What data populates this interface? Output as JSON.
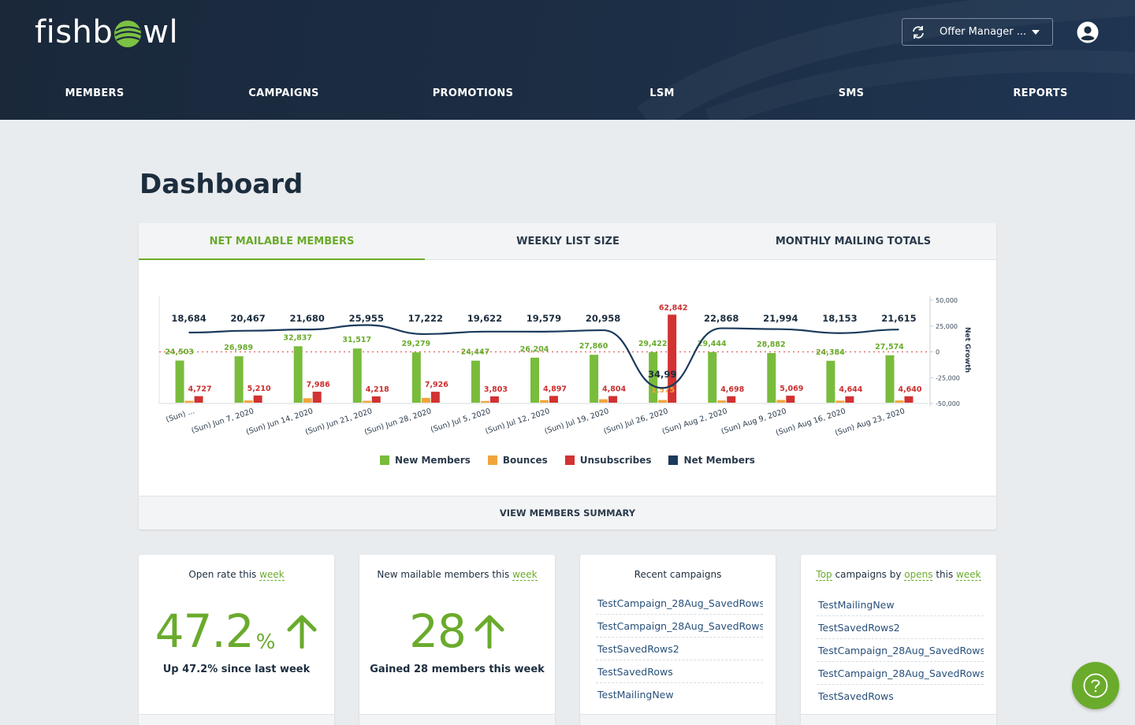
{
  "header": {
    "logo_text_left": "fishb",
    "logo_text_right": "wl",
    "account_selector": "Offer Manager ...",
    "icons": {
      "sync": "refresh-icon",
      "caret": "caret-down-icon",
      "user": "user-circle-icon"
    }
  },
  "nav": [
    "MEMBERS",
    "CAMPAIGNS",
    "PROMOTIONS",
    "LSM",
    "SMS",
    "REPORTS"
  ],
  "page_title": "Dashboard",
  "tabs": [
    "NET MAILABLE MEMBERS",
    "WEEKLY LIST SIZE",
    "MONTHLY MAILING TOTALS"
  ],
  "active_tab": "NET MAILABLE MEMBERS",
  "colors": {
    "accent": "#6aab2c",
    "new_members": "#79bc3c",
    "bounces": "#f0a53c",
    "unsubscribes": "#d23232",
    "net_members": "#1b3a5c"
  },
  "chart_data": {
    "type": "bar",
    "categories": [
      "(Sun) ...",
      "(Sun) Jun 7, 2020",
      "(Sun) Jun 14, 2020",
      "(Sun) Jun 21, 2020",
      "(Sun) Jun 28, 2020",
      "(Sun) Jul 5, 2020",
      "(Sun) Jul 12, 2020",
      "(Sun) Jul 19, 2020",
      "(Sun) Jul 26, 2020",
      "(Sun) Aug 2, 2020",
      "(Sun) Aug 9, 2020",
      "(Sun) Aug 16, 2020",
      "(Sun) Aug 23, 2020"
    ],
    "series": [
      {
        "name": "New Members",
        "type": "bar",
        "values": [
          24503,
          26989,
          32837,
          31517,
          29279,
          24447,
          26204,
          27860,
          29422,
          29444,
          28882,
          24384,
          27574
        ]
      },
      {
        "name": "Bounces",
        "type": "bar",
        "values": [
          1100,
          1300,
          2600,
          1100,
          2800,
          1000,
          1500,
          2000,
          1575,
          1300,
          1600,
          1200,
          1300
        ]
      },
      {
        "name": "Unsubscribes",
        "type": "bar",
        "values": [
          4727,
          5210,
          7986,
          4218,
          7926,
          3803,
          4897,
          4804,
          62842,
          4698,
          5069,
          4644,
          4640
        ]
      },
      {
        "name": "Net Members",
        "type": "line",
        "axis": "right",
        "values": [
          18684,
          20467,
          21680,
          25955,
          17222,
          19622,
          19579,
          20958,
          -34996,
          22868,
          21994,
          18153,
          21615
        ]
      }
    ],
    "bounce_labels": {
      "8": "1,575"
    },
    "net_label_override": {
      "8": "34,99"
    },
    "y2_ticks": [
      "50,000",
      "25,000",
      "0",
      "-25,000",
      "-50,000"
    ],
    "y2label": "Net Growth",
    "y2lim": [
      -50000,
      50000
    ],
    "legend_position": "bottom"
  },
  "legend": [
    "New Members",
    "Bounces",
    "Unsubscribes",
    "Net Members"
  ],
  "view_summary": "VIEW MEMBERS SUMMARY",
  "widgets": {
    "open_rate": {
      "title_pre": "Open rate this",
      "title_link": "week",
      "value": "47.2",
      "unit": "%",
      "subtitle": "Up 47.2% since last week"
    },
    "new_members": {
      "title_pre": "New mailable members this",
      "title_link": "week",
      "value": "28",
      "subtitle": "Gained 28 members this week"
    },
    "recent_campaigns": {
      "title": "Recent campaigns",
      "items": [
        "TestCampaign_28Aug_SavedRows...",
        "TestCampaign_28Aug_SavedRows",
        "TestSavedRows2",
        "TestSavedRows",
        "TestMailingNew"
      ]
    },
    "top_campaigns": {
      "title_parts": [
        "Top",
        "campaigns by",
        "opens",
        "this",
        "week"
      ],
      "items": [
        "TestMailingNew",
        "TestSavedRows2",
        "TestCampaign_28Aug_SavedRows",
        "TestCampaign_28Aug_SavedRows...",
        "TestSavedRows"
      ]
    }
  },
  "help_icon": "question-circle-icon"
}
